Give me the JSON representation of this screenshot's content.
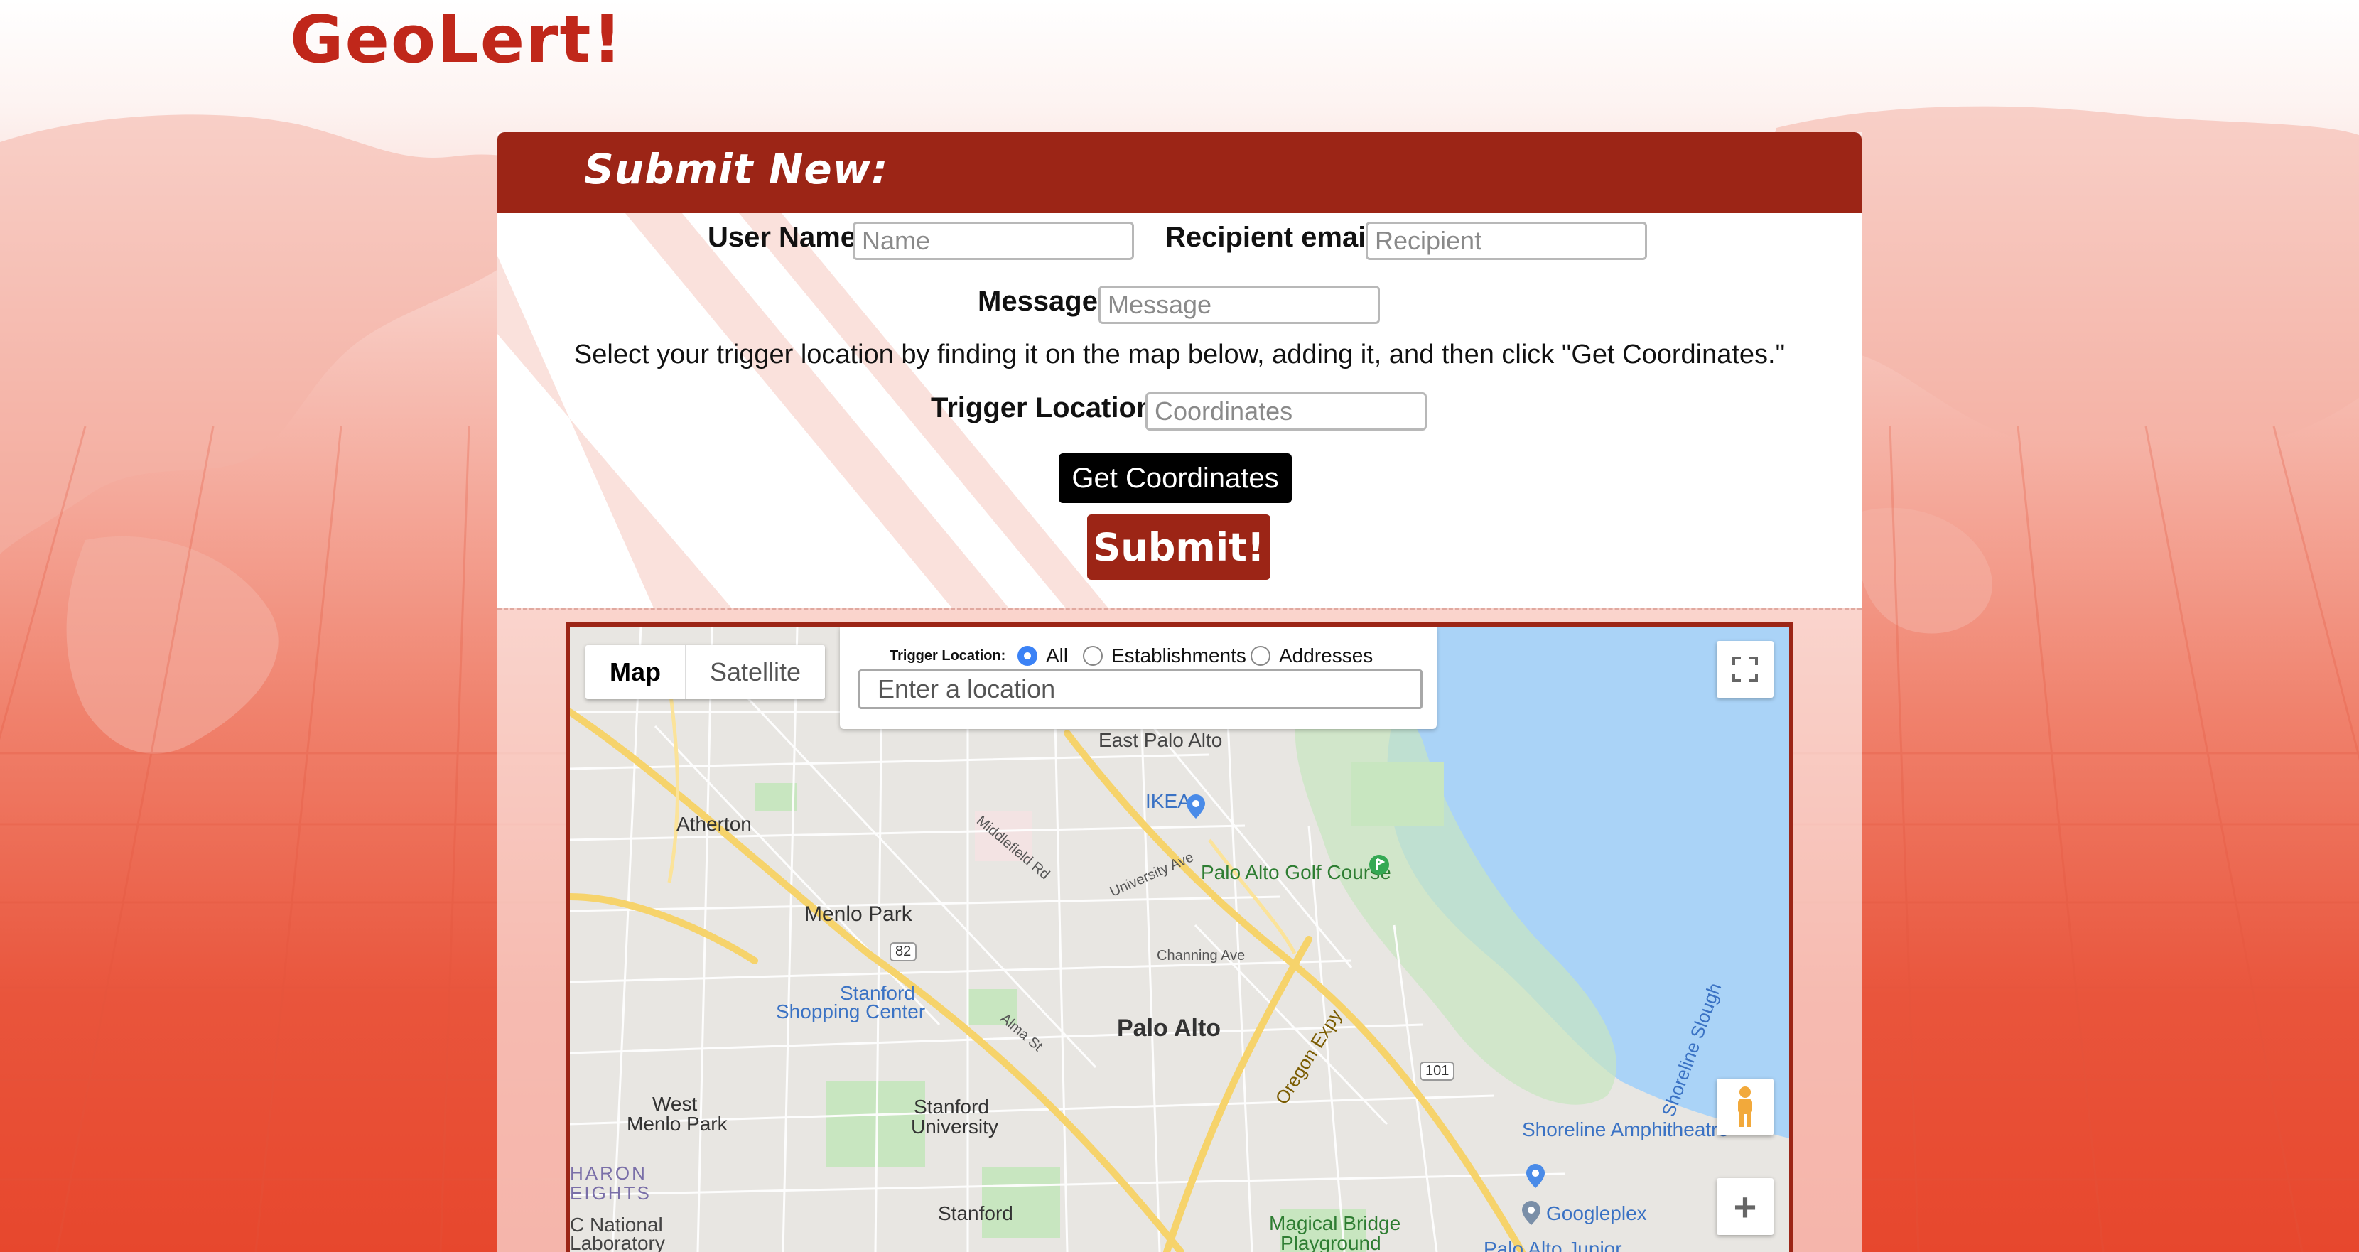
{
  "app": {
    "logo": "GeoLert!"
  },
  "panel": {
    "title": "Submit New:"
  },
  "form": {
    "username_label": "User Name",
    "username_placeholder": "Name",
    "recipient_label": "Recipient email",
    "recipient_placeholder": "Recipient",
    "message_label": "Message",
    "message_placeholder": "Message",
    "instruction": "Select your trigger location by finding it on the map below, adding it, and then click \"Get Coordinates.\"",
    "trigger_label": "Trigger Location",
    "trigger_placeholder": "Coordinates",
    "get_coordinates": "Get Coordinates",
    "submit": "Submit!"
  },
  "map": {
    "type_map": "Map",
    "type_satellite": "Satellite",
    "search_title": "Trigger Location:",
    "radio_all": "All",
    "radio_establishments": "Establishments",
    "radio_addresses": "Addresses",
    "selected_filter": "All",
    "location_placeholder": "Enter a location",
    "zoom_in": "+",
    "labels": {
      "east_palo_alto": "East Palo Alto",
      "ikea": "IKEA",
      "atherton": "Atherton",
      "palo_alto_golf": "Palo Alto Golf Course",
      "menlo_park": "Menlo Park",
      "stanford_shopping_1": "Stanford",
      "stanford_shopping_2": "Shopping Center",
      "palo_alto": "Palo Alto",
      "west_menlo_1": "West",
      "west_menlo_2": "Menlo Park",
      "stanford_univ_1": "Stanford",
      "stanford_univ_2": "University",
      "stanford": "Stanford",
      "ladera_1": "HARON",
      "ladera_2": "EIGHTS",
      "slac_1": "C National",
      "slac_2": "Laboratory",
      "shoreline_amph": "Shoreline Amphitheatre",
      "googleplex": "Googleplex",
      "magical_bridge_1": "Magical Bridge",
      "magical_bridge_2": "Playground",
      "palo_alto_junior": "Palo Alto Junior",
      "oregon_expy": "Oregon Expy",
      "shoreline_slough": "Shoreline Slough",
      "university_ave": "University Ave",
      "channing_ave": "Channing Ave",
      "middlefield_rd": "Middlefield Rd",
      "alma_st": "Alma St",
      "hwy_82": "82",
      "hwy_101": "101"
    }
  }
}
